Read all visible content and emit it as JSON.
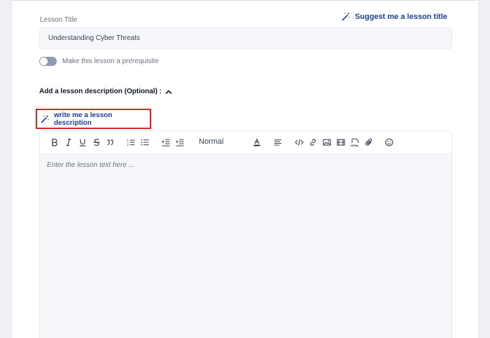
{
  "lesson_title": {
    "label": "Lesson Title",
    "value": "Understanding Cyber Threats"
  },
  "suggest_title": {
    "label": "Suggest me a lesson title"
  },
  "prerequisite": {
    "label": "Make this lesson a prerequisite",
    "enabled": false
  },
  "description": {
    "header": "Add a lesson description (Optional) :",
    "write_button": "write me a lesson description"
  },
  "editor": {
    "block_format": "Normal",
    "placeholder": "Enter the lesson text here ..."
  },
  "colors": {
    "accent": "#1d3fa8",
    "highlight_border": "#e02424",
    "input_bg": "#f5f7fa"
  },
  "icons": {
    "suggest": "magic-wand-icon",
    "write": "magic-wand-icon",
    "toolbar": [
      "bold-icon",
      "italic-icon",
      "underline-icon",
      "strikethrough-icon",
      "quote-icon",
      "ordered-list-icon",
      "bullet-list-icon",
      "outdent-icon",
      "indent-icon",
      "text-color-icon",
      "align-icon",
      "code-icon",
      "link-icon",
      "image-icon",
      "video-icon",
      "html-icon",
      "attachment-icon",
      "emoji-icon"
    ]
  }
}
